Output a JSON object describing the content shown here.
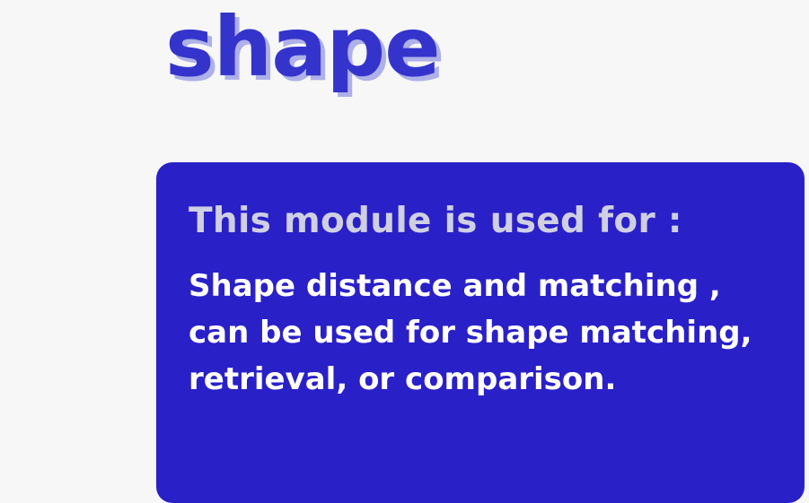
{
  "slide": {
    "title": "shape",
    "card": {
      "heading": "This module is used for :",
      "body": "Shape distance and matching , can be used for shape matching, retrieval, or comparison."
    }
  }
}
